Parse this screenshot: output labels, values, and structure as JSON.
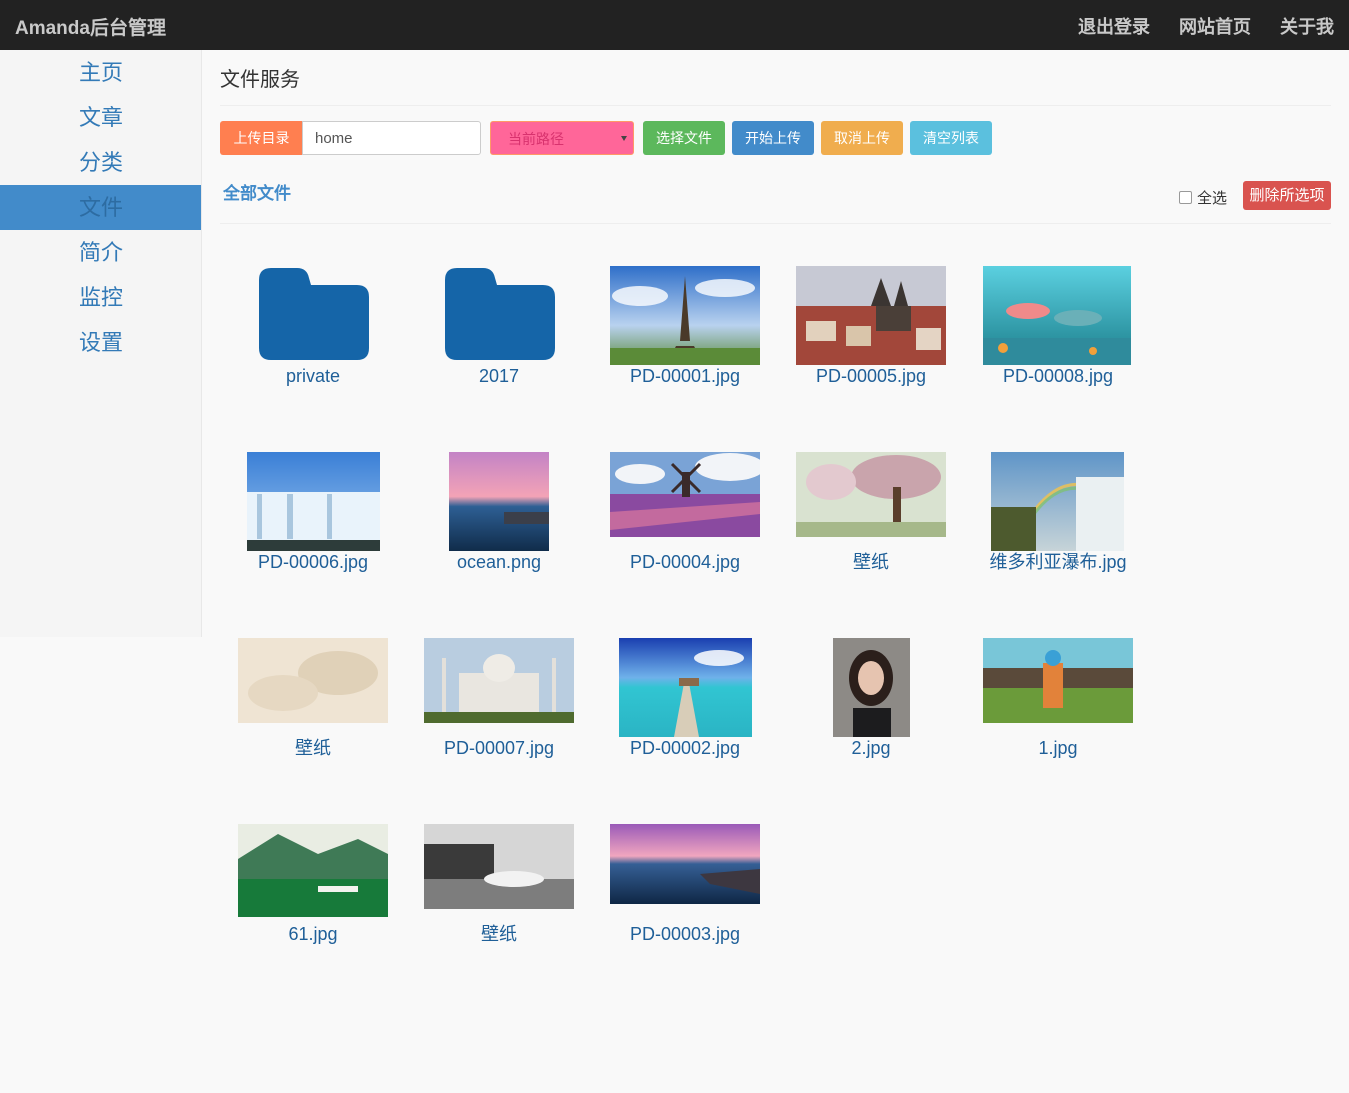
{
  "header": {
    "brand": "Amanda后台管理",
    "nav": [
      "退出登录",
      "网站首页",
      "关于我"
    ]
  },
  "sidebar": {
    "items": [
      {
        "label": "主页"
      },
      {
        "label": "文章"
      },
      {
        "label": "分类"
      },
      {
        "label": "文件",
        "active": true
      },
      {
        "label": "简介"
      },
      {
        "label": "监控"
      },
      {
        "label": "设置"
      }
    ]
  },
  "main": {
    "title": "文件服务",
    "toolbar": {
      "upload_dir_label": "上传目录",
      "upload_dir_value": "home",
      "path_select": "当前路径",
      "choose_label": "选择文件",
      "start_label": "开始上传",
      "cancel_label": "取消上传",
      "clear_label": "清空列表"
    },
    "all_files_label": "全部文件",
    "select_all_label": "全选",
    "delete_label": "删除所选项"
  },
  "files": [
    {
      "name": "private",
      "type": "folder"
    },
    {
      "name": "2017",
      "type": "folder"
    },
    {
      "name": "PD-00001.jpg",
      "type": "image"
    },
    {
      "name": "PD-00005.jpg",
      "type": "image"
    },
    {
      "name": "PD-00008.jpg",
      "type": "image"
    },
    {
      "name": "PD-00006.jpg",
      "type": "image"
    },
    {
      "name": "ocean.png",
      "type": "image"
    },
    {
      "name": "PD-00004.jpg",
      "type": "image"
    },
    {
      "name": "壁纸",
      "type": "image"
    },
    {
      "name": "维多利亚瀑布.jpg",
      "type": "image"
    },
    {
      "name": "壁纸",
      "type": "image"
    },
    {
      "name": "PD-00007.jpg",
      "type": "image"
    },
    {
      "name": "PD-00002.jpg",
      "type": "image"
    },
    {
      "name": "2.jpg",
      "type": "image"
    },
    {
      "name": "1.jpg",
      "type": "image"
    },
    {
      "name": "61.jpg",
      "type": "image"
    },
    {
      "name": "壁纸",
      "type": "image"
    },
    {
      "name": "PD-00003.jpg",
      "type": "image"
    }
  ],
  "colors": {
    "topbar": "#222222",
    "active_sidebar": "#428bca",
    "folder": "#1565a8",
    "link": "#1f5f98"
  }
}
